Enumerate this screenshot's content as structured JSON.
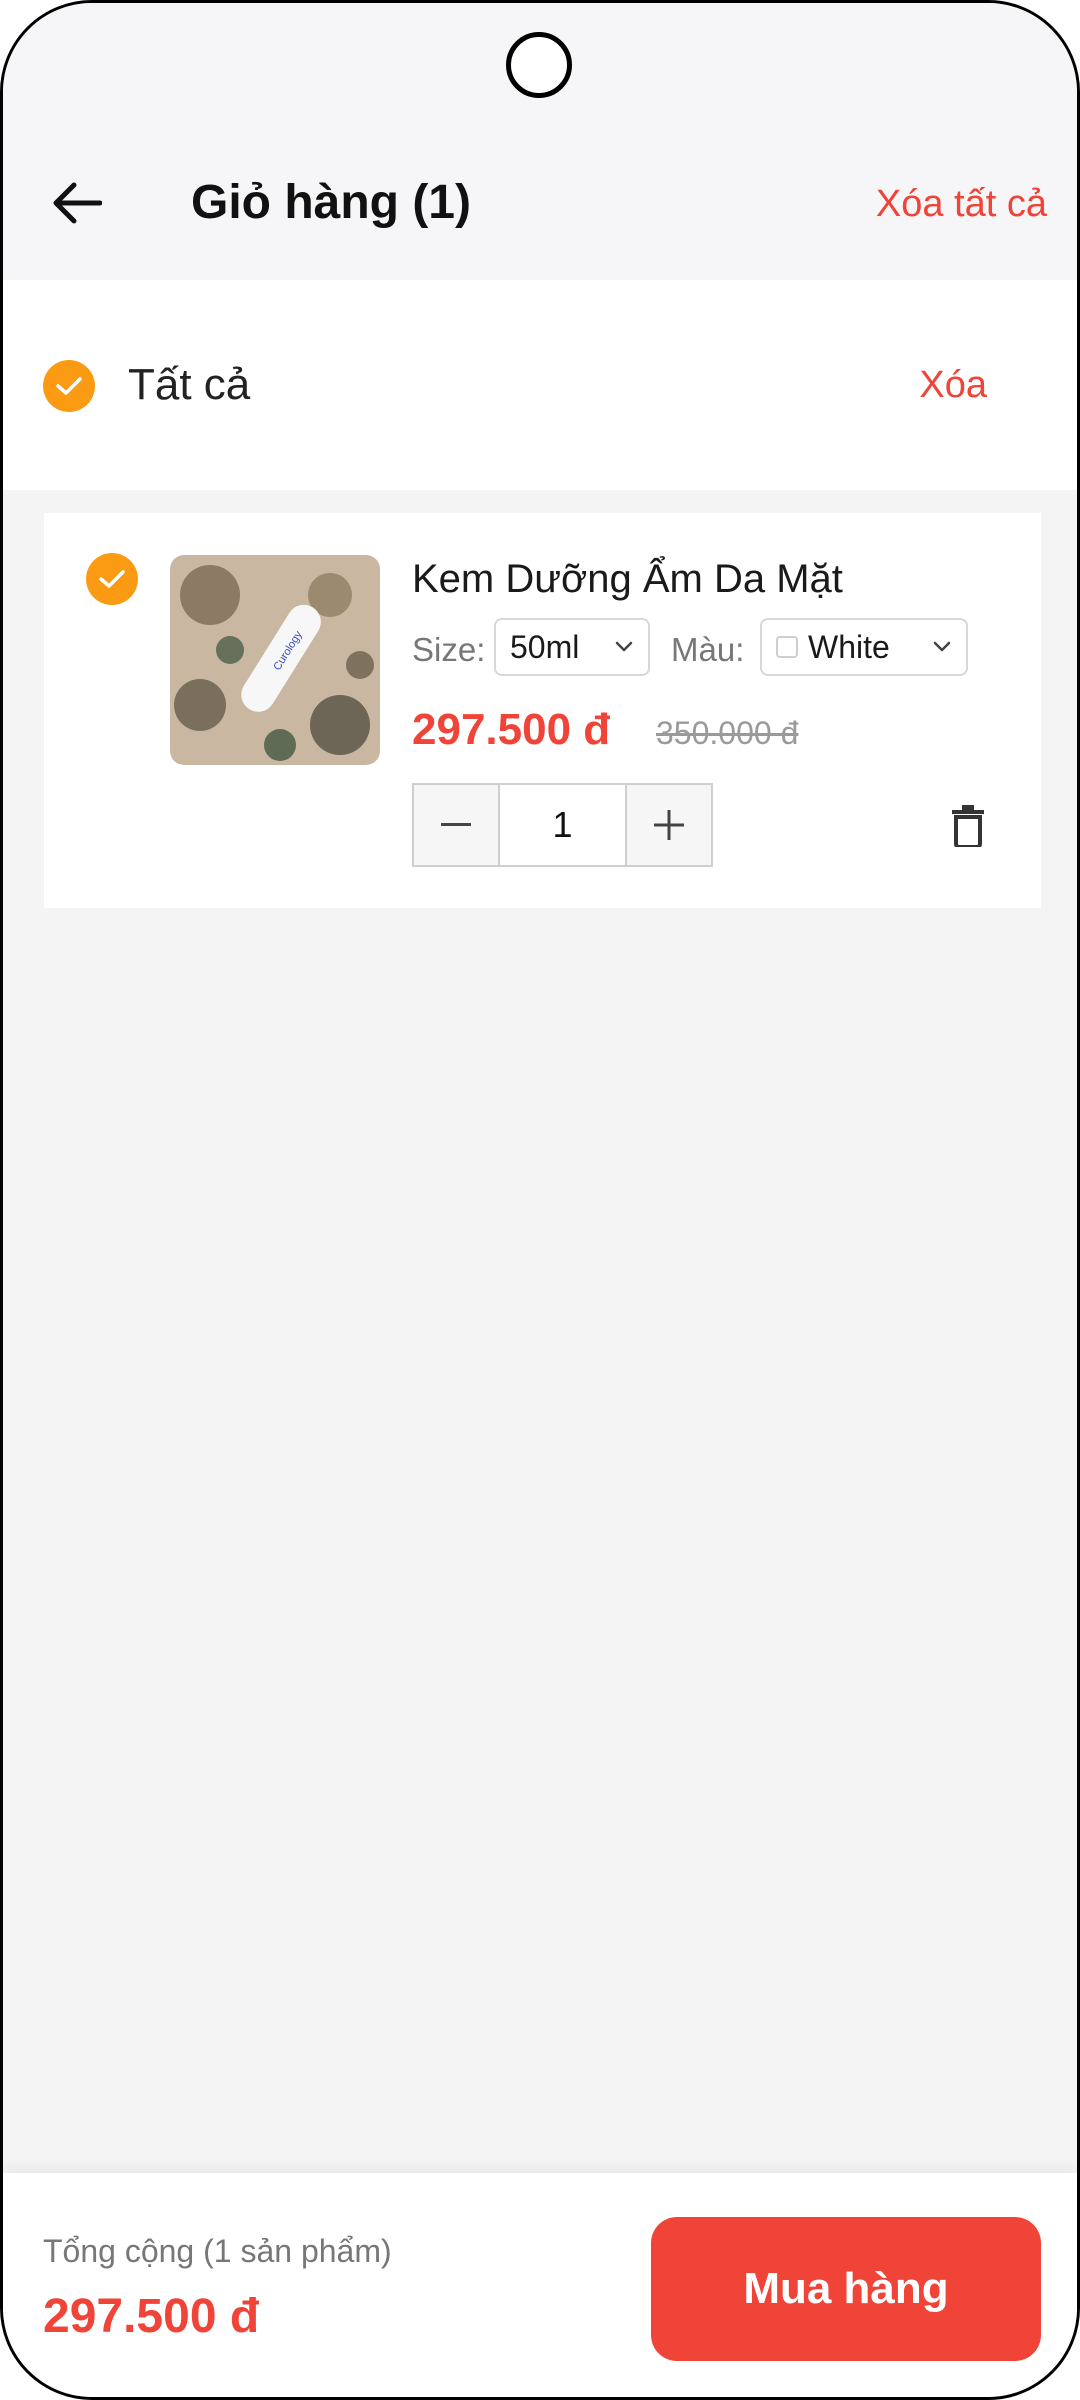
{
  "header": {
    "title": "Giỏ hàng (1)",
    "clear_all": "Xóa tất cả",
    "back_icon": "arrow-left-icon"
  },
  "select_all": {
    "label": "Tất cả",
    "checked": true,
    "delete": "Xóa"
  },
  "cart": {
    "items": [
      {
        "checked": true,
        "name": "Kem Dưỡng Ẩm Da Mặt",
        "size_label": "Size:",
        "size_value": "50ml",
        "color_label": "Màu:",
        "color_value": "White",
        "price": "297.500 đ",
        "old_price": "350.000 đ",
        "quantity": "1",
        "image_brand": "Curology"
      }
    ]
  },
  "footer": {
    "total_label": "Tổng cộng (1 sản phẩm)",
    "total_value": "297.500 đ",
    "buy_button": "Mua hàng"
  },
  "colors": {
    "accent_red": "#f04438",
    "check_orange": "#fb9a13"
  }
}
